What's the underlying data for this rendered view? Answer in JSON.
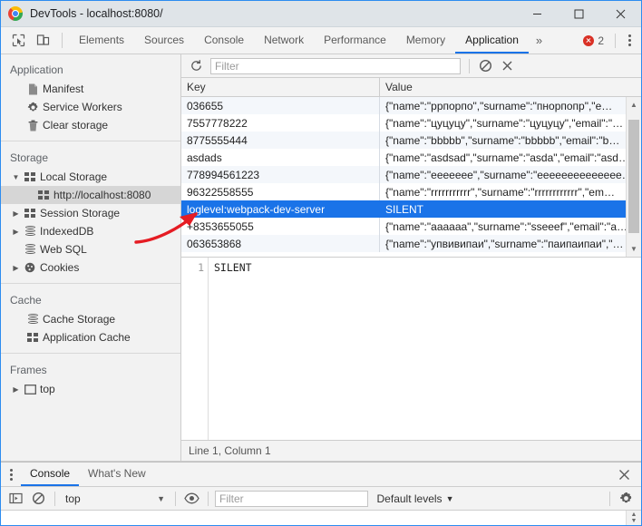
{
  "window": {
    "title": "DevTools - localhost:8080/",
    "logo_icon": "chrome-logo",
    "minimize_icon": "minimize-icon",
    "maximize_icon": "maximize-icon",
    "close_icon": "close-icon"
  },
  "tabbar": {
    "inspect_icon": "inspect-element-icon",
    "device_icon": "device-toolbar-icon",
    "tabs": [
      {
        "label": "Elements",
        "active": false
      },
      {
        "label": "Sources",
        "active": false
      },
      {
        "label": "Console",
        "active": false
      },
      {
        "label": "Network",
        "active": false
      },
      {
        "label": "Performance",
        "active": false
      },
      {
        "label": "Memory",
        "active": false
      },
      {
        "label": "Application",
        "active": true
      }
    ],
    "more_label": "»",
    "error_count": "2",
    "error_icon": "error-circle-icon",
    "menu_icon": "kebab-menu-icon"
  },
  "sidebar": {
    "sections": [
      {
        "title": "Application",
        "items": [
          {
            "label": "Manifest",
            "icon": "document-icon",
            "indent": 2,
            "arrow": "none",
            "selected": false
          },
          {
            "label": "Service Workers",
            "icon": "gear-icon",
            "indent": 2,
            "arrow": "none",
            "selected": false
          },
          {
            "label": "Clear storage",
            "icon": "trash-icon",
            "indent": 2,
            "arrow": "none",
            "selected": false
          }
        ]
      },
      {
        "title": "Storage",
        "items": [
          {
            "label": "Local Storage",
            "icon": "grid-icon",
            "indent": 1,
            "arrow": "expanded",
            "selected": false
          },
          {
            "label": "http://localhost:8080",
            "icon": "grid-icon",
            "indent": 3,
            "arrow": "none",
            "selected": true
          },
          {
            "label": "Session Storage",
            "icon": "grid-icon",
            "indent": 1,
            "arrow": "collapsed",
            "selected": false
          },
          {
            "label": "IndexedDB",
            "icon": "database-icon",
            "indent": 1,
            "arrow": "collapsed",
            "selected": false
          },
          {
            "label": "Web SQL",
            "icon": "database-icon",
            "indent": 2,
            "arrow": "none",
            "selected": false
          },
          {
            "label": "Cookies",
            "icon": "cookie-icon",
            "indent": 1,
            "arrow": "collapsed",
            "selected": false
          }
        ]
      },
      {
        "title": "Cache",
        "items": [
          {
            "label": "Cache Storage",
            "icon": "database-icon",
            "indent": 2,
            "arrow": "none",
            "selected": false
          },
          {
            "label": "Application Cache",
            "icon": "grid-icon",
            "indent": 2,
            "arrow": "none",
            "selected": false
          }
        ]
      },
      {
        "title": "Frames",
        "items": [
          {
            "label": "top",
            "icon": "frame-icon",
            "indent": 1,
            "arrow": "collapsed",
            "selected": false
          }
        ]
      }
    ]
  },
  "storage_toolbar": {
    "refresh_icon": "refresh-icon",
    "filter_placeholder": "Filter",
    "filter_value": "",
    "clear_all_icon": "clear-all-icon",
    "delete_icon": "delete-selected-icon"
  },
  "table": {
    "columns": [
      "Key",
      "Value"
    ],
    "rows": [
      {
        "key": "036655",
        "value": "{\"name\":\"ррпорпо\",\"surname\":\"пнорпопр\",\"e…",
        "selected": false
      },
      {
        "key": "7557778222",
        "value": "{\"name\":\"цуцуцу\",\"surname\":\"цуцуцу\",\"email\":\"…",
        "selected": false
      },
      {
        "key": "8775555444",
        "value": "{\"name\":\"bbbbb\",\"surname\":\"bbbbb\",\"email\":\"b…",
        "selected": false
      },
      {
        "key": "asdads",
        "value": "{\"name\":\"asdsad\",\"surname\":\"asda\",\"email\":\"asd…",
        "selected": false
      },
      {
        "key": "778994561223",
        "value": "{\"name\":\"eeeeeee\",\"surname\":\"eeeeeeeeeeeeee…",
        "selected": false
      },
      {
        "key": "96322558555",
        "value": "{\"name\":\"rrrrrrrrrrr\",\"surname\":\"rrrrrrrrrrrr\",\"em…",
        "selected": false
      },
      {
        "key": "loglevel:webpack-dev-server",
        "value": "SILENT",
        "selected": true
      },
      {
        "key": "+8353655055",
        "value": "{\"name\":\"aaaaaa\",\"surname\":\"sseeef\",\"email\":\"a…",
        "selected": false
      },
      {
        "key": "063653868",
        "value": "{\"name\":\"упвивипаи\",\"surname\":\"паипаипаи\",\"…",
        "selected": false
      }
    ],
    "scrollbar_up_icon": "scroll-up-icon",
    "scrollbar_down_icon": "scroll-down-icon"
  },
  "preview": {
    "line_number": "1",
    "content": "SILENT",
    "status": "Line 1, Column 1"
  },
  "drawer": {
    "menu_icon": "kebab-menu-icon",
    "tabs": [
      {
        "label": "Console",
        "active": true
      },
      {
        "label": "What's New",
        "active": false
      }
    ],
    "close_icon": "close-icon",
    "toolbar": {
      "sidebar_toggle_icon": "console-sidebar-icon",
      "clear_console_icon": "clear-console-icon",
      "context_value": "top",
      "context_caret_icon": "chevron-down-icon",
      "eye_icon": "live-expression-icon",
      "filter_placeholder": "Filter",
      "filter_value": "",
      "levels_label": "Default levels",
      "levels_caret_icon": "chevron-down-icon",
      "settings_icon": "gear-icon"
    }
  },
  "annotation": {
    "type": "red-arrow",
    "color": "#e51c23"
  },
  "colors": {
    "accent": "#1a73e8",
    "titlebar": "#dfe4e8",
    "toolbar": "#f3f3f3",
    "error": "#d93025",
    "selection": "#1a73e8",
    "row_alt": "#f4f7fb"
  }
}
